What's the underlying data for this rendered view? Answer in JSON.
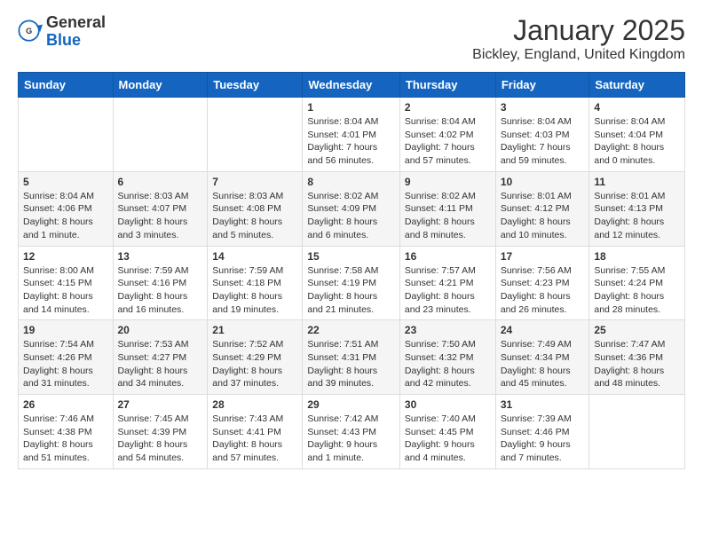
{
  "header": {
    "logo_general": "General",
    "logo_blue": "Blue",
    "title": "January 2025",
    "subtitle": "Bickley, England, United Kingdom"
  },
  "weekdays": [
    "Sunday",
    "Monday",
    "Tuesday",
    "Wednesday",
    "Thursday",
    "Friday",
    "Saturday"
  ],
  "weeks": [
    [
      {
        "day": "",
        "info": ""
      },
      {
        "day": "",
        "info": ""
      },
      {
        "day": "",
        "info": ""
      },
      {
        "day": "1",
        "info": "Sunrise: 8:04 AM\nSunset: 4:01 PM\nDaylight: 7 hours and 56 minutes."
      },
      {
        "day": "2",
        "info": "Sunrise: 8:04 AM\nSunset: 4:02 PM\nDaylight: 7 hours and 57 minutes."
      },
      {
        "day": "3",
        "info": "Sunrise: 8:04 AM\nSunset: 4:03 PM\nDaylight: 7 hours and 59 minutes."
      },
      {
        "day": "4",
        "info": "Sunrise: 8:04 AM\nSunset: 4:04 PM\nDaylight: 8 hours and 0 minutes."
      }
    ],
    [
      {
        "day": "5",
        "info": "Sunrise: 8:04 AM\nSunset: 4:06 PM\nDaylight: 8 hours and 1 minute."
      },
      {
        "day": "6",
        "info": "Sunrise: 8:03 AM\nSunset: 4:07 PM\nDaylight: 8 hours and 3 minutes."
      },
      {
        "day": "7",
        "info": "Sunrise: 8:03 AM\nSunset: 4:08 PM\nDaylight: 8 hours and 5 minutes."
      },
      {
        "day": "8",
        "info": "Sunrise: 8:02 AM\nSunset: 4:09 PM\nDaylight: 8 hours and 6 minutes."
      },
      {
        "day": "9",
        "info": "Sunrise: 8:02 AM\nSunset: 4:11 PM\nDaylight: 8 hours and 8 minutes."
      },
      {
        "day": "10",
        "info": "Sunrise: 8:01 AM\nSunset: 4:12 PM\nDaylight: 8 hours and 10 minutes."
      },
      {
        "day": "11",
        "info": "Sunrise: 8:01 AM\nSunset: 4:13 PM\nDaylight: 8 hours and 12 minutes."
      }
    ],
    [
      {
        "day": "12",
        "info": "Sunrise: 8:00 AM\nSunset: 4:15 PM\nDaylight: 8 hours and 14 minutes."
      },
      {
        "day": "13",
        "info": "Sunrise: 7:59 AM\nSunset: 4:16 PM\nDaylight: 8 hours and 16 minutes."
      },
      {
        "day": "14",
        "info": "Sunrise: 7:59 AM\nSunset: 4:18 PM\nDaylight: 8 hours and 19 minutes."
      },
      {
        "day": "15",
        "info": "Sunrise: 7:58 AM\nSunset: 4:19 PM\nDaylight: 8 hours and 21 minutes."
      },
      {
        "day": "16",
        "info": "Sunrise: 7:57 AM\nSunset: 4:21 PM\nDaylight: 8 hours and 23 minutes."
      },
      {
        "day": "17",
        "info": "Sunrise: 7:56 AM\nSunset: 4:23 PM\nDaylight: 8 hours and 26 minutes."
      },
      {
        "day": "18",
        "info": "Sunrise: 7:55 AM\nSunset: 4:24 PM\nDaylight: 8 hours and 28 minutes."
      }
    ],
    [
      {
        "day": "19",
        "info": "Sunrise: 7:54 AM\nSunset: 4:26 PM\nDaylight: 8 hours and 31 minutes."
      },
      {
        "day": "20",
        "info": "Sunrise: 7:53 AM\nSunset: 4:27 PM\nDaylight: 8 hours and 34 minutes."
      },
      {
        "day": "21",
        "info": "Sunrise: 7:52 AM\nSunset: 4:29 PM\nDaylight: 8 hours and 37 minutes."
      },
      {
        "day": "22",
        "info": "Sunrise: 7:51 AM\nSunset: 4:31 PM\nDaylight: 8 hours and 39 minutes."
      },
      {
        "day": "23",
        "info": "Sunrise: 7:50 AM\nSunset: 4:32 PM\nDaylight: 8 hours and 42 minutes."
      },
      {
        "day": "24",
        "info": "Sunrise: 7:49 AM\nSunset: 4:34 PM\nDaylight: 8 hours and 45 minutes."
      },
      {
        "day": "25",
        "info": "Sunrise: 7:47 AM\nSunset: 4:36 PM\nDaylight: 8 hours and 48 minutes."
      }
    ],
    [
      {
        "day": "26",
        "info": "Sunrise: 7:46 AM\nSunset: 4:38 PM\nDaylight: 8 hours and 51 minutes."
      },
      {
        "day": "27",
        "info": "Sunrise: 7:45 AM\nSunset: 4:39 PM\nDaylight: 8 hours and 54 minutes."
      },
      {
        "day": "28",
        "info": "Sunrise: 7:43 AM\nSunset: 4:41 PM\nDaylight: 8 hours and 57 minutes."
      },
      {
        "day": "29",
        "info": "Sunrise: 7:42 AM\nSunset: 4:43 PM\nDaylight: 9 hours and 1 minute."
      },
      {
        "day": "30",
        "info": "Sunrise: 7:40 AM\nSunset: 4:45 PM\nDaylight: 9 hours and 4 minutes."
      },
      {
        "day": "31",
        "info": "Sunrise: 7:39 AM\nSunset: 4:46 PM\nDaylight: 9 hours and 7 minutes."
      },
      {
        "day": "",
        "info": ""
      }
    ]
  ]
}
